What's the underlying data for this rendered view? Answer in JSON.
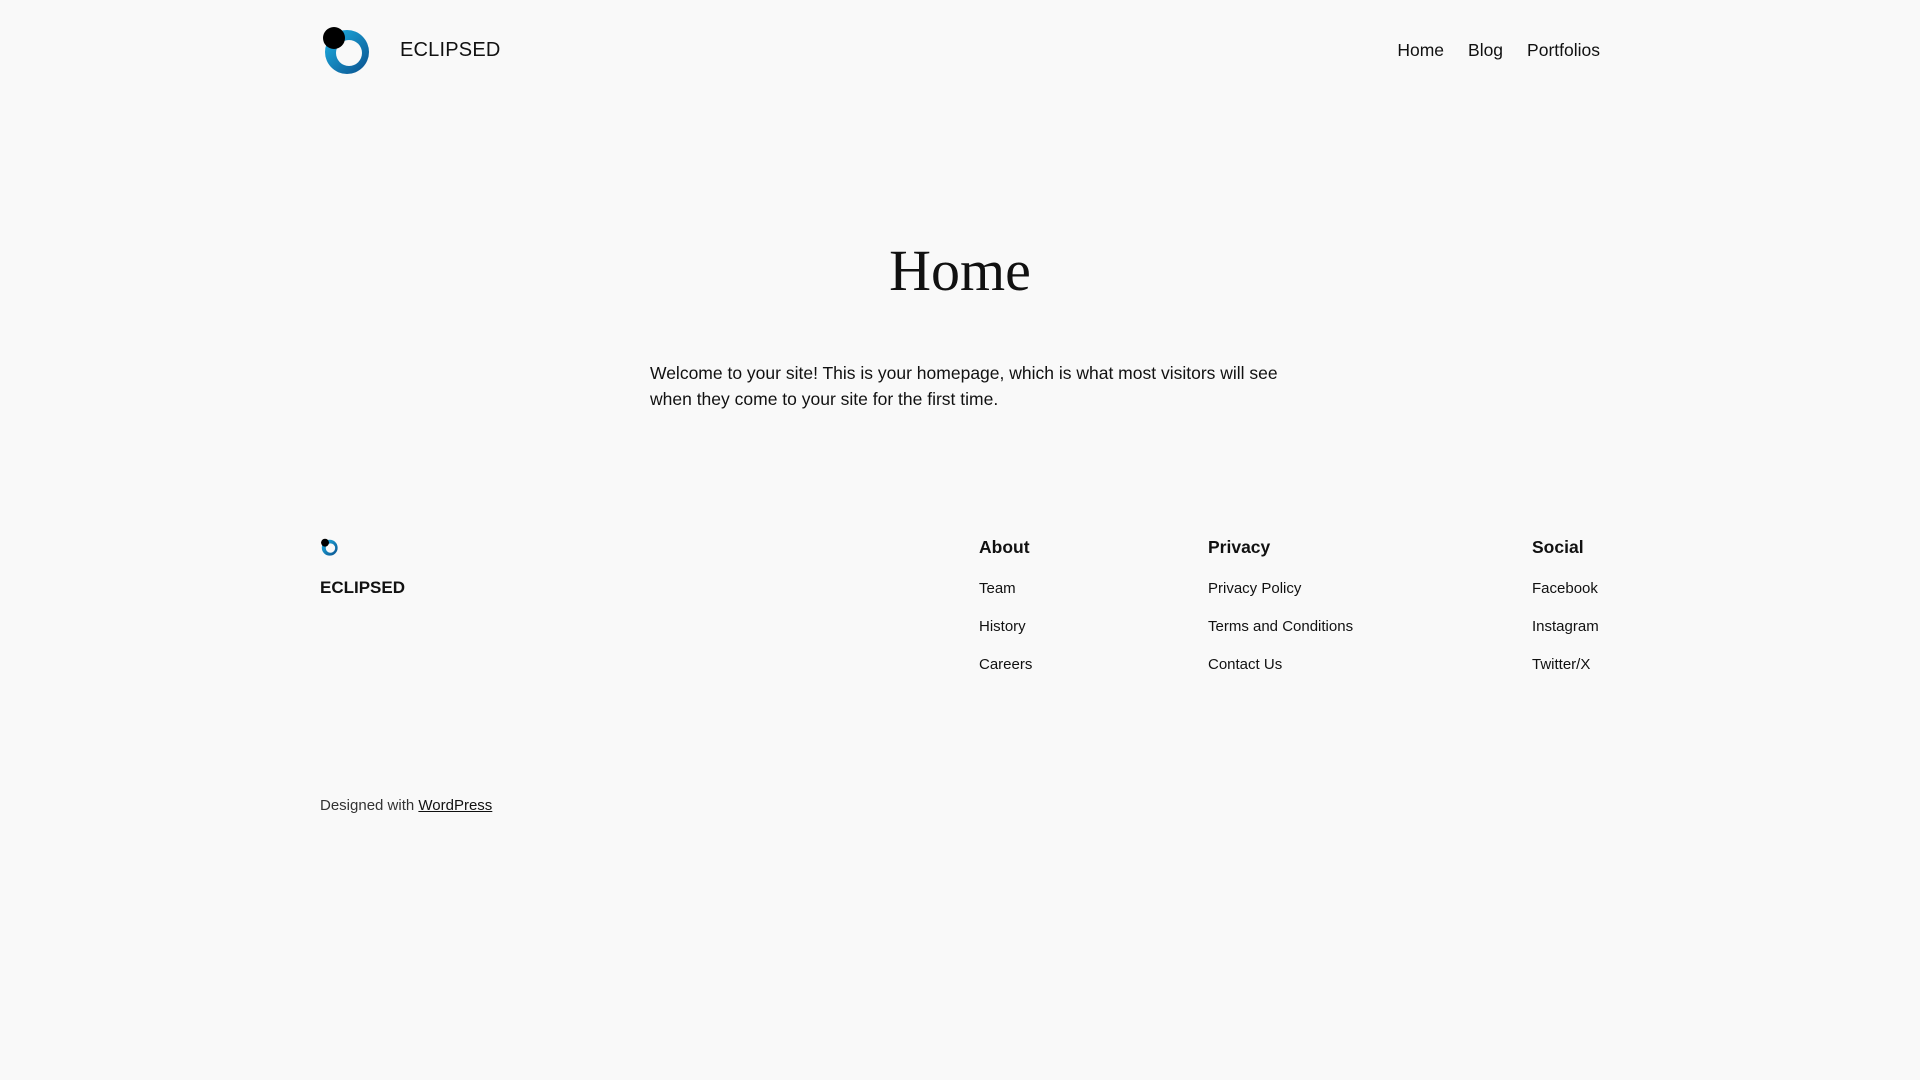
{
  "header": {
    "site_title": "ECLIPSED",
    "nav": [
      {
        "label": "Home"
      },
      {
        "label": "Blog"
      },
      {
        "label": "Portfolios"
      }
    ]
  },
  "main": {
    "title": "Home",
    "intro": "Welcome to your site! This is your homepage, which is what most visitors will see when they come to your site for the first time."
  },
  "footer": {
    "site_title": "ECLIPSED",
    "columns": [
      {
        "heading": "About",
        "links": [
          "Team",
          "History",
          "Careers"
        ]
      },
      {
        "heading": "Privacy",
        "links": [
          "Privacy Policy",
          "Terms and Conditions",
          "Contact Us"
        ]
      },
      {
        "heading": "Social",
        "links": [
          "Facebook",
          "Instagram",
          "Twitter/X"
        ]
      }
    ],
    "credit_prefix": "Designed with ",
    "credit_link": "WordPress"
  },
  "colors": {
    "background": "#f9f9f9",
    "text": "#111111",
    "logo_blue_light": "#1fb4e6",
    "logo_blue_dark": "#0a4f8c",
    "logo_black": "#000000"
  },
  "icons": {
    "logo": "eclipse-logo-icon"
  }
}
